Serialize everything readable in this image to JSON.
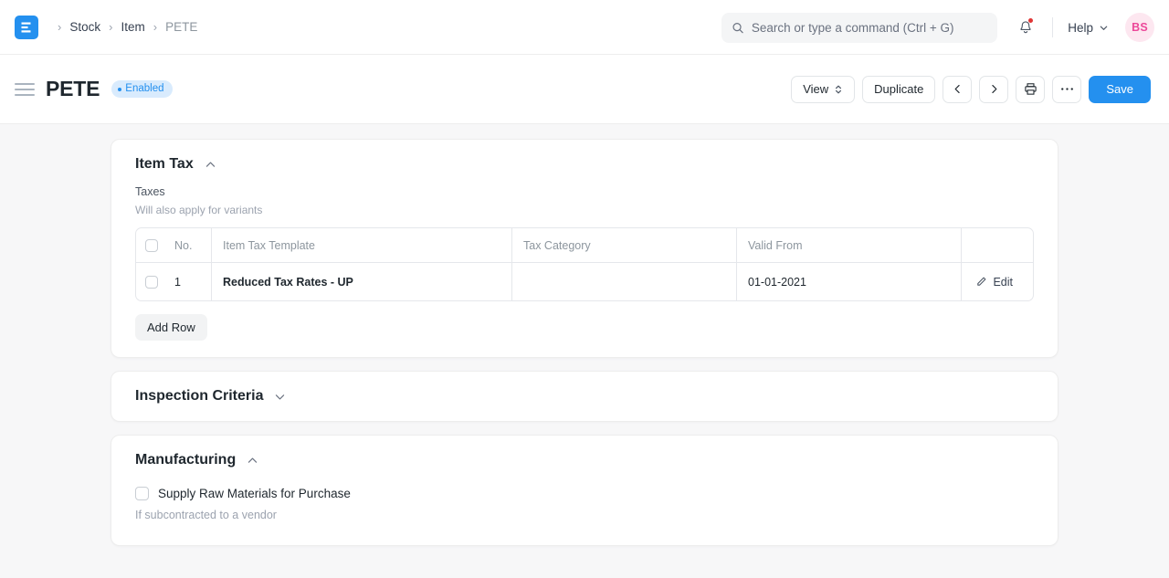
{
  "navbar": {
    "logo_letter": "E",
    "breadcrumbs": [
      {
        "label": "Stock",
        "current": false
      },
      {
        "label": "Item",
        "current": false
      },
      {
        "label": "PETE",
        "current": true
      }
    ],
    "separator": "›",
    "search": {
      "placeholder": "Search or type a command (Ctrl + G)",
      "value": "",
      "icon": "search-icon"
    },
    "notifications": {
      "icon": "bell-icon",
      "has_unread": true,
      "dot_color": "#e03636"
    },
    "help": {
      "label": "Help",
      "icon": "chevron-down-icon"
    },
    "avatar": {
      "initials": "BS",
      "bg": "#fde7f0",
      "fg": "#ec4899"
    }
  },
  "toolbar": {
    "menu_icon": "hamburger-icon",
    "title": "PETE",
    "status": {
      "label": "Enabled",
      "color": "#2490ef",
      "bg": "#d9ebfd"
    },
    "view_label": "View",
    "duplicate_label": "Duplicate",
    "prev_icon": "chevron-left-icon",
    "next_icon": "chevron-right-icon",
    "print_icon": "printer-icon",
    "more_icon": "ellipsis-icon",
    "save_label": "Save",
    "save_color": "#2490ef"
  },
  "sections": {
    "item_tax": {
      "title": "Item Tax",
      "collapsed": false,
      "chevron": "chevron-up-icon",
      "field_label": "Taxes",
      "field_help": "Will also apply for variants",
      "table": {
        "columns": [
          "No.",
          "Item Tax Template",
          "Tax Category",
          "Valid From",
          ""
        ],
        "rows": [
          {
            "no": "1",
            "item_tax_template": "Reduced Tax Rates - UP",
            "tax_category": "",
            "valid_from": "01-01-2021",
            "edit_label": "Edit",
            "edit_icon": "pencil-icon"
          }
        ]
      },
      "add_row_label": "Add Row"
    },
    "inspection_criteria": {
      "title": "Inspection Criteria",
      "collapsed": true,
      "chevron": "chevron-down-icon"
    },
    "manufacturing": {
      "title": "Manufacturing",
      "collapsed": false,
      "chevron": "chevron-up-icon",
      "checkbox_label": "Supply Raw Materials for Purchase",
      "checkbox_checked": false,
      "checkbox_help": "If subcontracted to a vendor"
    }
  }
}
